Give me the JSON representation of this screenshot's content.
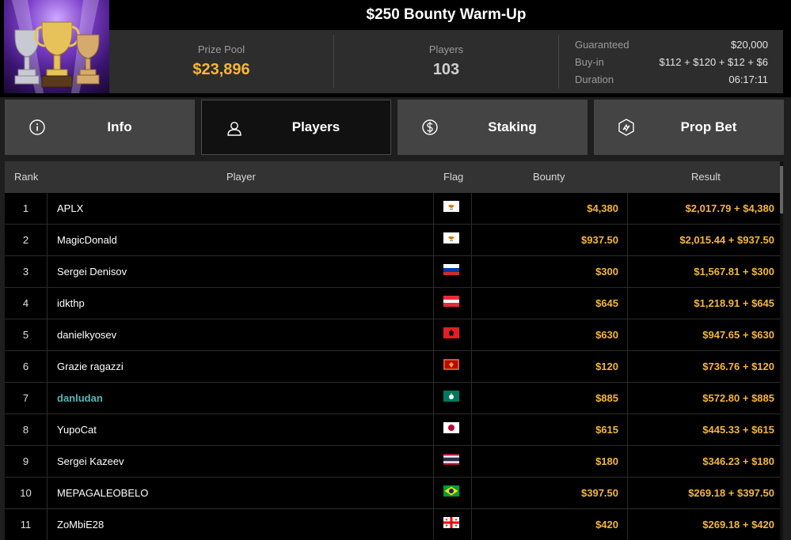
{
  "tournament": {
    "title": "$250 Bounty Warm-Up",
    "prize_pool_label": "Prize Pool",
    "prize_pool": "$23,896",
    "players_label": "Players",
    "players": "103",
    "details": [
      {
        "label": "Guaranteed",
        "value": "$20,000"
      },
      {
        "label": "Buy-in",
        "value": "$112 + $120 + $12 + $6"
      },
      {
        "label": "Duration",
        "value": "06:17:11"
      }
    ]
  },
  "tabs": [
    {
      "label": "Info",
      "icon": "info-icon",
      "active": false
    },
    {
      "label": "Players",
      "icon": "user-icon",
      "active": true
    },
    {
      "label": "Staking",
      "icon": "dollar-coin-icon",
      "active": false
    },
    {
      "label": "Prop Bet",
      "icon": "prop-bet-icon",
      "active": false
    }
  ],
  "table": {
    "headers": {
      "rank": "Rank",
      "player": "Player",
      "flag": "Flag",
      "bounty": "Bounty",
      "result": "Result"
    },
    "rows": [
      {
        "rank": "1",
        "player": "APLX",
        "flag": "cyprus",
        "bounty": "$4,380",
        "result": "$2,017.79 + $4,380"
      },
      {
        "rank": "2",
        "player": "MagicDonald",
        "flag": "cyprus",
        "bounty": "$937.50",
        "result": "$2,015.44 + $937.50"
      },
      {
        "rank": "3",
        "player": "Sergei Denisov",
        "flag": "russia",
        "bounty": "$300",
        "result": "$1,567.81 + $300"
      },
      {
        "rank": "4",
        "player": "idkthp",
        "flag": "austria",
        "bounty": "$645",
        "result": "$1,218.91 + $645"
      },
      {
        "rank": "5",
        "player": "danielkyosev",
        "flag": "albania",
        "bounty": "$630",
        "result": "$947.65 + $630"
      },
      {
        "rank": "6",
        "player": "Grazie ragazzi",
        "flag": "montenegro",
        "bounty": "$120",
        "result": "$736.76 + $120"
      },
      {
        "rank": "7",
        "player": "danludan",
        "flag": "macau",
        "bounty": "$885",
        "result": "$572.80 + $885",
        "highlight": true
      },
      {
        "rank": "8",
        "player": "YupoCat",
        "flag": "japan",
        "bounty": "$615",
        "result": "$445.33 + $615"
      },
      {
        "rank": "9",
        "player": "Sergei Kazeev",
        "flag": "thailand",
        "bounty": "$180",
        "result": "$346.23 + $180"
      },
      {
        "rank": "10",
        "player": "MEPAGALEOBELO",
        "flag": "brazil",
        "bounty": "$397.50",
        "result": "$269.18 + $397.50"
      },
      {
        "rank": "11",
        "player": "ZoMbiE28",
        "flag": "georgia",
        "bounty": "$420",
        "result": "$269.18 + $420"
      }
    ]
  },
  "colors": {
    "accent_gold": "#f5b63a",
    "highlight_teal": "#55b8b6",
    "tab_bg": "#444444",
    "header_bg": "#000000"
  }
}
